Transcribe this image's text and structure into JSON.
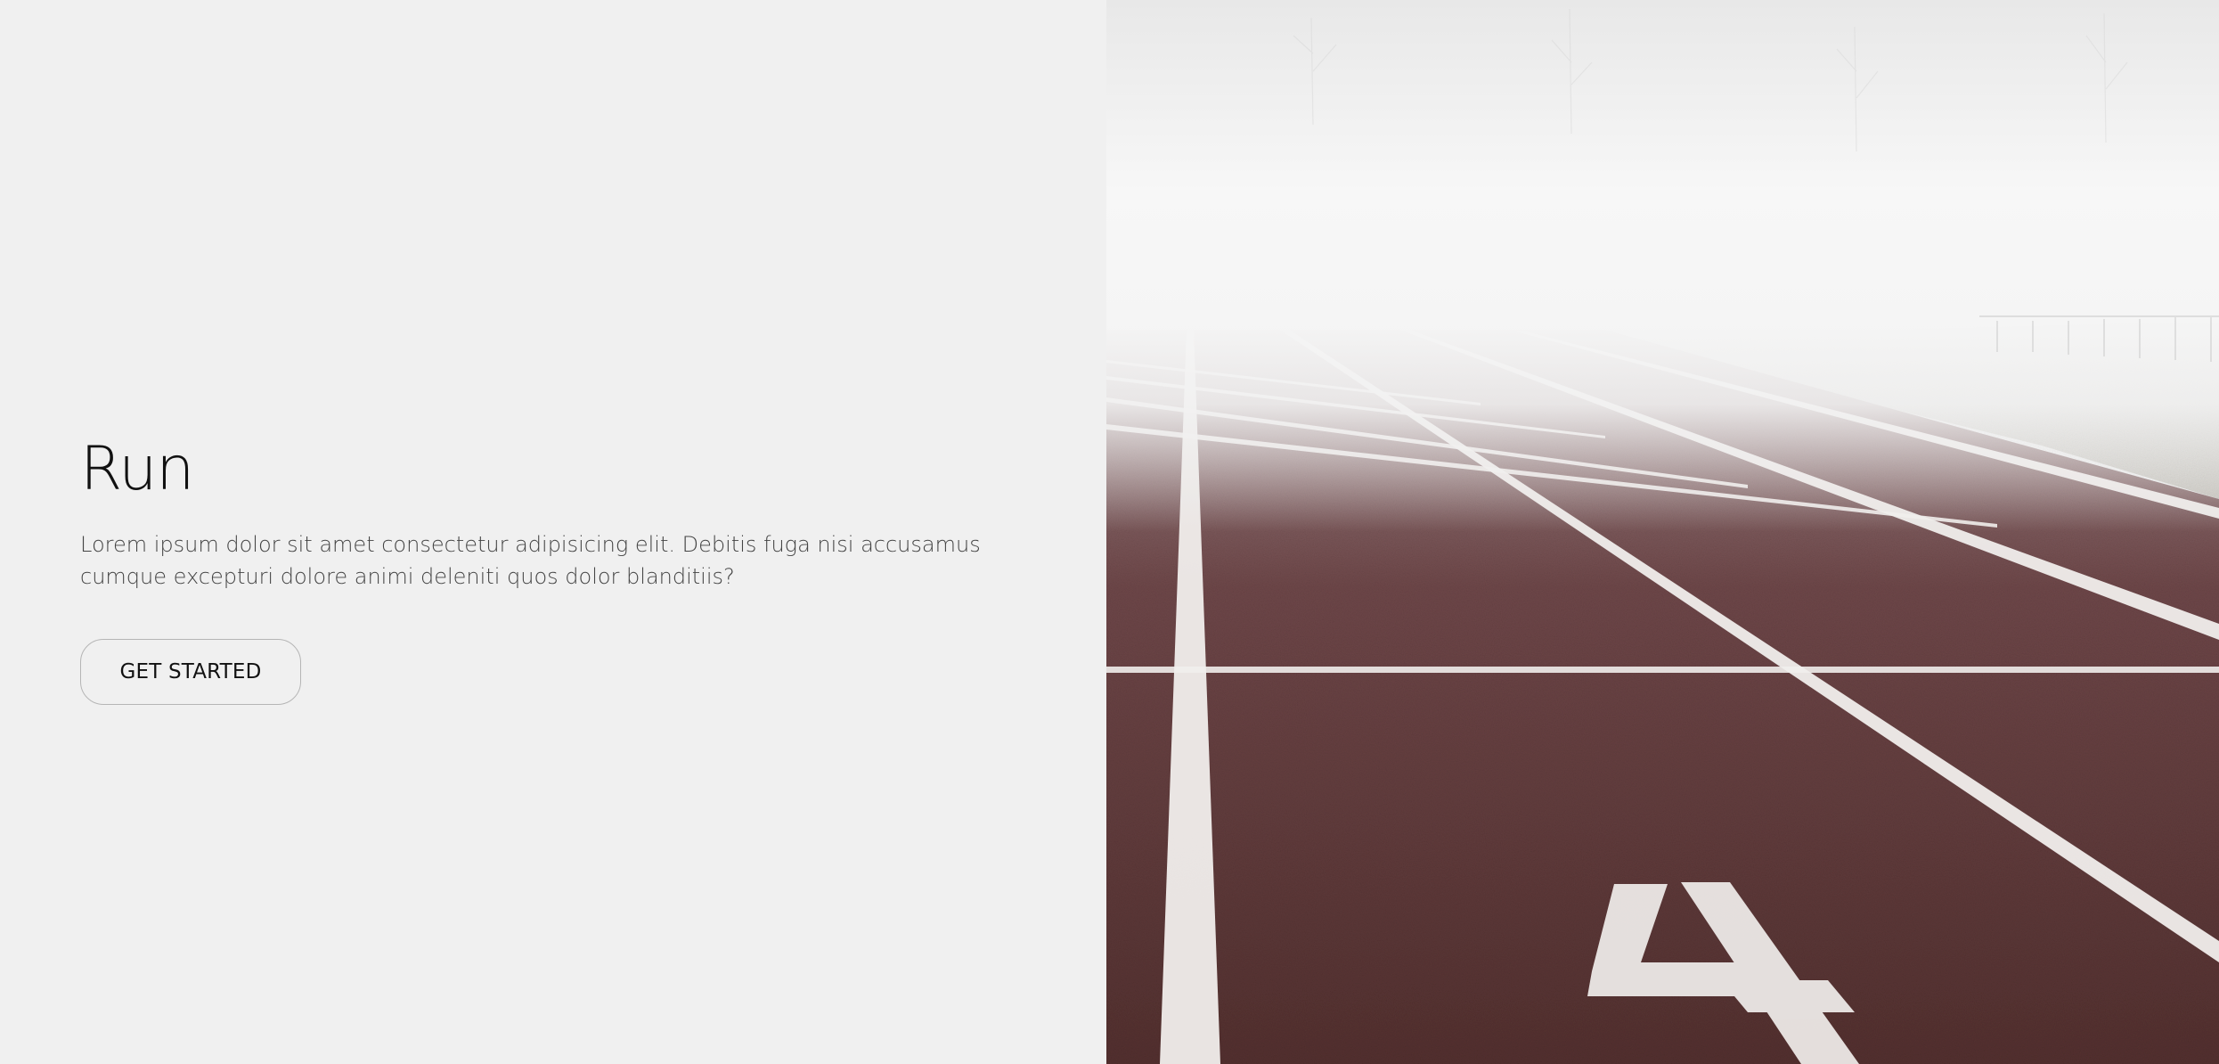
{
  "hero": {
    "title": "Run",
    "description": "Lorem ipsum dolor sit amet consectetur adipisicing elit. Debitis fuga nisi accusamus cumque excepturi dolore animi deleniti quos dolor blanditiis?",
    "cta_label": "GET STARTED"
  },
  "image": {
    "subject": "running-track-lane-4",
    "lane_number": "4"
  },
  "colors": {
    "background": "#f0f0f0",
    "track": "#5a3335",
    "track_lines": "#f2f0ee",
    "fog": "#f4f4f4"
  }
}
